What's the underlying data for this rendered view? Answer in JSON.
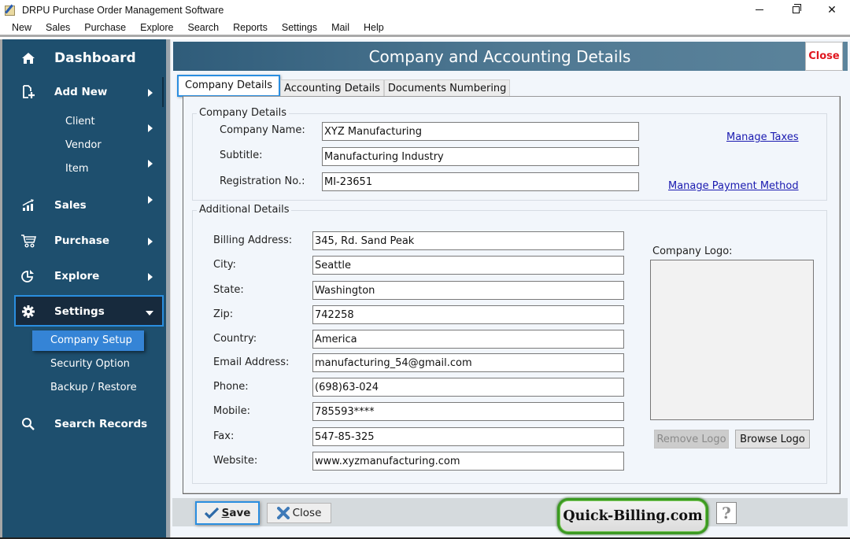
{
  "window": {
    "title": "DRPU Purchase Order Management Software",
    "controls": {
      "minimize": "minimize",
      "maximize": "restore",
      "close": "✕"
    }
  },
  "menu": [
    "New",
    "Sales",
    "Purchase",
    "Explore",
    "Search",
    "Reports",
    "Settings",
    "Mail",
    "Help"
  ],
  "sidebar": {
    "dashboard": "Dashboard",
    "add_new": "Add New",
    "add_new_items": [
      "Client",
      "Vendor",
      "Item"
    ],
    "sales": "Sales",
    "purchase": "Purchase",
    "explore": "Explore",
    "settings": "Settings",
    "settings_items": [
      "Company Setup",
      "Security Option",
      "Backup / Restore"
    ],
    "active_item": "Company Setup",
    "search_records": "Search Records"
  },
  "header": {
    "title": "Company and Accounting Details",
    "close_label": "Close"
  },
  "tabs": [
    {
      "label": "Company Details",
      "active": true
    },
    {
      "label": "Accounting Details",
      "active": false
    },
    {
      "label": "Documents Numbering",
      "active": false
    }
  ],
  "company_details": {
    "legend": "Company Details",
    "fields": [
      {
        "label": "Company Name:",
        "value": "XYZ Manufacturing"
      },
      {
        "label": "Subtitle:",
        "value": "Manufacturing Industry"
      },
      {
        "label": "Registration No.:",
        "value": "MI-23651"
      }
    ],
    "links": {
      "manage_taxes": "Manage Taxes",
      "manage_payment": "Manage Payment Method"
    }
  },
  "additional_details": {
    "legend": "Additional Details",
    "fields": [
      {
        "label": "Billing Address:",
        "value": "345, Rd. Sand Peak"
      },
      {
        "label": "City:",
        "value": "Seattle"
      },
      {
        "label": "State:",
        "value": "Washington"
      },
      {
        "label": "Zip:",
        "value": "742258"
      },
      {
        "label": "Country:",
        "value": "America"
      },
      {
        "label": "Email Address:",
        "value": "manufacturing_54@gmail.com"
      },
      {
        "label": "Phone:",
        "value": "(698)63-024"
      },
      {
        "label": "Mobile:",
        "value": "785593****"
      },
      {
        "label": "Fax:",
        "value": "547-85-325"
      },
      {
        "label": "Website:",
        "value": "www.xyzmanufacturing.com"
      }
    ],
    "logo": {
      "label": "Company Logo:",
      "remove_label": "Remove Logo",
      "browse_label": "Browse Logo"
    }
  },
  "footer": {
    "save_label": "ave",
    "save_mnemonic": "S",
    "close_label": "Close",
    "brand": "Quick-Billing.com",
    "help": "?"
  },
  "colors": {
    "sidebar_bg": "#1e4f6e",
    "accent_blue": "#2a8ee0",
    "active_item": "#3584d6",
    "close_red": "#e0171f",
    "brand_green": "#3c9a22"
  }
}
